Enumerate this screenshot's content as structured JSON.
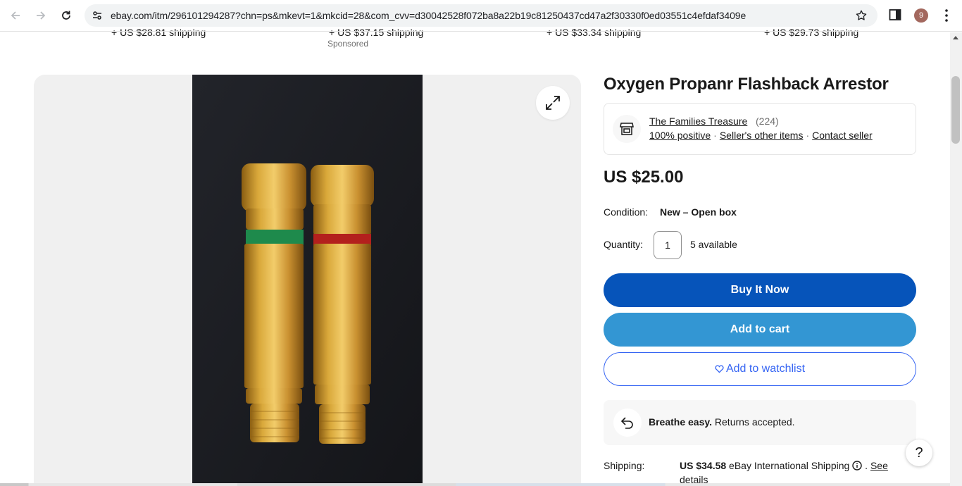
{
  "browser": {
    "url": "ebay.com/itm/296101294287?chn=ps&mkevt=1&mkcid=28&com_cvv=d30042528f072ba8a22b19c81250437cd47a2f30330f0ed03551c4efdaf3409e",
    "profile_initial": "9"
  },
  "carousel": {
    "items": [
      {
        "shipping": "+ US $28.81 shipping"
      },
      {
        "shipping": "+ US $37.15 shipping"
      },
      {
        "shipping": "+ US $33.34 shipping"
      },
      {
        "shipping": "+ US $29.73 shipping"
      }
    ],
    "sponsored_label": "Sponsored"
  },
  "listing": {
    "title": "Oxygen Propanr Flashback Arrestor",
    "seller": {
      "name": "The Families Treasure",
      "feedback_count": "(224)",
      "positive": "100% positive",
      "other_items": "Seller's other items",
      "contact": "Contact seller"
    },
    "price": "US $25.00",
    "condition_label": "Condition:",
    "condition_value": "New – Open box",
    "quantity_label": "Quantity:",
    "quantity_value": "1",
    "available": "5 available",
    "buttons": {
      "buy_now": "Buy It Now",
      "add_to_cart": "Add to cart",
      "watchlist": "Add to watchlist"
    },
    "returns": {
      "bold": "Breathe easy.",
      "text": " Returns accepted."
    },
    "shipping": {
      "label": "Shipping:",
      "amount": "US $34.58",
      "method": " eBay International Shipping",
      "see": "See",
      "details": "details"
    }
  },
  "help_label": "?",
  "colors": {
    "buy_now": "#0654ba",
    "add_to_cart": "#3396d3",
    "link_blue": "#3665f3",
    "brass": "#c99a2e",
    "oxygen_band": "#1e8a4c",
    "fuel_band": "#b3201d"
  }
}
